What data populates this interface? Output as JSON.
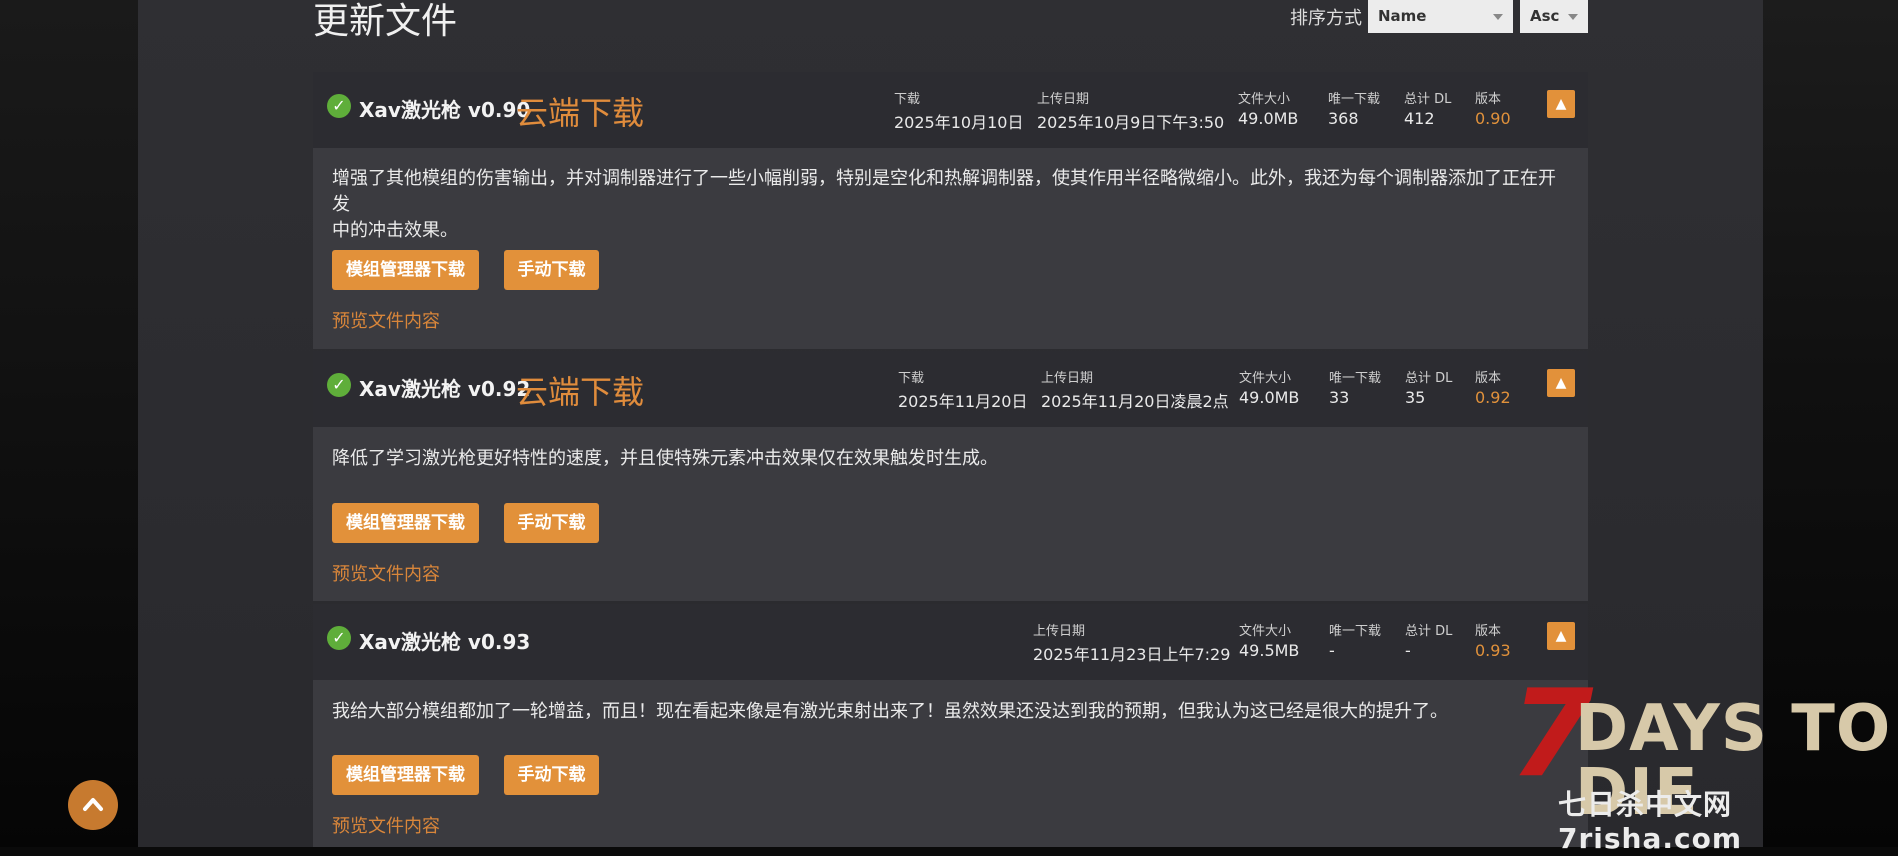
{
  "page": {
    "title": "更新文件"
  },
  "sort": {
    "label": "排序方式",
    "field": "Name",
    "order": "Asc"
  },
  "files": [
    {
      "name": "Xav激光枪 v0.90",
      "cloud": "云端下载",
      "stats": [
        {
          "label": "下载",
          "value": "2025年10月10日",
          "orange": false
        },
        {
          "label": "上传日期",
          "value": "2025年10月9日下午3:50",
          "orange": false
        },
        {
          "label": "文件大小",
          "value": "49.0MB",
          "orange": false
        },
        {
          "label": "唯一下载",
          "value": "368",
          "orange": false
        },
        {
          "label": "总计 DL",
          "value": "412",
          "orange": false
        },
        {
          "label": "版本",
          "value": "0.90",
          "orange": true
        }
      ],
      "description_lines": [
        "增强了其他模组的伤害输出，并对调制器进行了一些小幅削弱，特别是空化和热解调制器，使其作用半径略微缩小。此外，我还为每个调制器添加了正在开发",
        "中的冲击效果。"
      ],
      "buttons": {
        "mod_manager": "模组管理器下载",
        "manual": "手动下载"
      },
      "preview": "预览文件内容"
    },
    {
      "name": "Xav激光枪 v0.92",
      "cloud": "云端下载",
      "stats": [
        {
          "label": "下载",
          "value": "2025年11月20日",
          "orange": false
        },
        {
          "label": "上传日期",
          "value": "2025年11月20日凌晨2点",
          "orange": false
        },
        {
          "label": "文件大小",
          "value": "49.0MB",
          "orange": false
        },
        {
          "label": "唯一下载",
          "value": "33",
          "orange": false
        },
        {
          "label": "总计 DL",
          "value": "35",
          "orange": false
        },
        {
          "label": "版本",
          "value": "0.92",
          "orange": true
        }
      ],
      "description_lines": [
        "降低了学习激光枪更好特性的速度，并且使特殊元素冲击效果仅在效果触发时生成。"
      ],
      "buttons": {
        "mod_manager": "模组管理器下载",
        "manual": "手动下载"
      },
      "preview": "预览文件内容"
    },
    {
      "name": "Xav激光枪 v0.93",
      "cloud": "",
      "stats": [
        {
          "label": "上传日期",
          "value": "2025年11月23日上午7:29",
          "orange": false
        },
        {
          "label": "文件大小",
          "value": "49.5MB",
          "orange": false
        },
        {
          "label": "唯一下载",
          "value": "-",
          "orange": false
        },
        {
          "label": "总计 DL",
          "value": "-",
          "orange": false
        },
        {
          "label": "版本",
          "value": "0.93",
          "orange": true
        }
      ],
      "description_lines": [
        "我给大部分模组都加了一轮增益，而且！现在看起来像是有激光束射出来了！虽然效果还没达到我的预期，但我认为这已经是很大的提升了。"
      ],
      "buttons": {
        "mod_manager": "模组管理器下载",
        "manual": "手动下载"
      },
      "preview": "预览文件内容"
    }
  ],
  "watermark": {
    "seven": "7",
    "title": "DAYS TO DIE",
    "subtitle": "七日杀中文网7risha.com"
  },
  "icons": {
    "check": "check-icon",
    "collapse": "chevron-up-icon",
    "scroll_top": "chevron-up-icon"
  },
  "colors": {
    "accent": "#e2913a",
    "check": "#5fae3a",
    "cloud_text": "#e08c3c"
  }
}
